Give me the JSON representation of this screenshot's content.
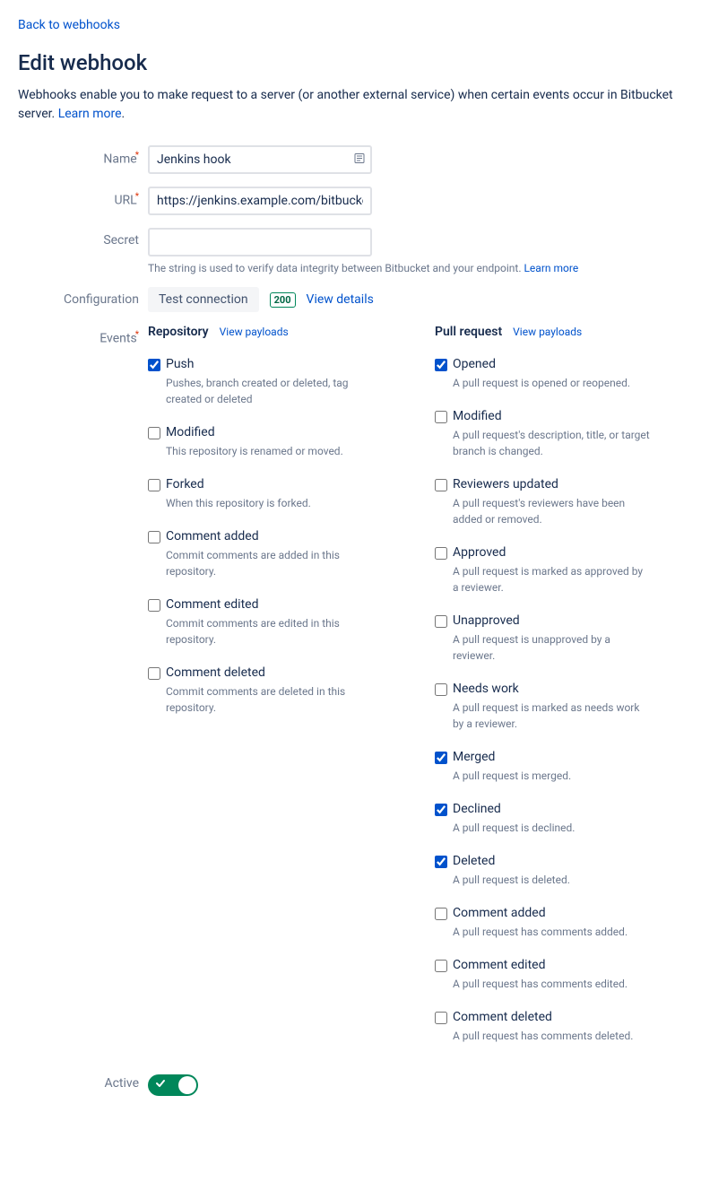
{
  "back_link": "Back to webhooks",
  "title": "Edit webhook",
  "description_text": "Webhooks enable you to make request to a server (or another external service) when certain events occur in Bitbucket server. ",
  "learn_more": "Learn more",
  "period": ".",
  "form": {
    "name_label": "Name",
    "name_value": "Jenkins hook",
    "url_label": "URL",
    "url_value": "https://jenkins.example.com/bitbucket",
    "secret_label": "Secret",
    "secret_value": "",
    "secret_help": "The string is used to verify data integrity between Bitbucket and your endpoint. ",
    "config_label": "Configuration",
    "test_button": "Test connection",
    "status_code": "200",
    "view_details": "View details",
    "events_label": "Events",
    "active_label": "Active"
  },
  "events": {
    "repo": {
      "title": "Repository",
      "view": "View payloads",
      "items": [
        {
          "name": "Push",
          "desc": "Pushes, branch created or deleted, tag created or deleted",
          "checked": true
        },
        {
          "name": "Modified",
          "desc": "This repository is renamed or moved.",
          "checked": false
        },
        {
          "name": "Forked",
          "desc": "When this repository is forked.",
          "checked": false
        },
        {
          "name": "Comment added",
          "desc": "Commit comments are added in this repository.",
          "checked": false
        },
        {
          "name": "Comment edited",
          "desc": "Commit comments are edited in this repository.",
          "checked": false
        },
        {
          "name": "Comment deleted",
          "desc": "Commit comments are deleted in this repository.",
          "checked": false
        }
      ]
    },
    "pr": {
      "title": "Pull request",
      "view": "View payloads",
      "items": [
        {
          "name": "Opened",
          "desc": "A pull request is opened or reopened.",
          "checked": true
        },
        {
          "name": "Modified",
          "desc": "A pull request's description, title, or target branch is changed.",
          "checked": false
        },
        {
          "name": "Reviewers updated",
          "desc": "A pull request's reviewers have been added or removed.",
          "checked": false
        },
        {
          "name": "Approved",
          "desc": "A pull request is marked as approved by a reviewer.",
          "checked": false
        },
        {
          "name": "Unapproved",
          "desc": "A pull request is unapproved by a reviewer.",
          "checked": false
        },
        {
          "name": "Needs work",
          "desc": "A pull request is marked as needs work by a reviewer.",
          "checked": false
        },
        {
          "name": "Merged",
          "desc": "A pull request is merged.",
          "checked": true
        },
        {
          "name": "Declined",
          "desc": "A pull request is declined.",
          "checked": true
        },
        {
          "name": "Deleted",
          "desc": "A pull request is deleted.",
          "checked": true
        },
        {
          "name": "Comment added",
          "desc": "A pull request has comments added.",
          "checked": false
        },
        {
          "name": "Comment edited",
          "desc": "A pull request has comments edited.",
          "checked": false
        },
        {
          "name": "Comment deleted",
          "desc": "A pull request has comments deleted.",
          "checked": false
        }
      ]
    }
  }
}
